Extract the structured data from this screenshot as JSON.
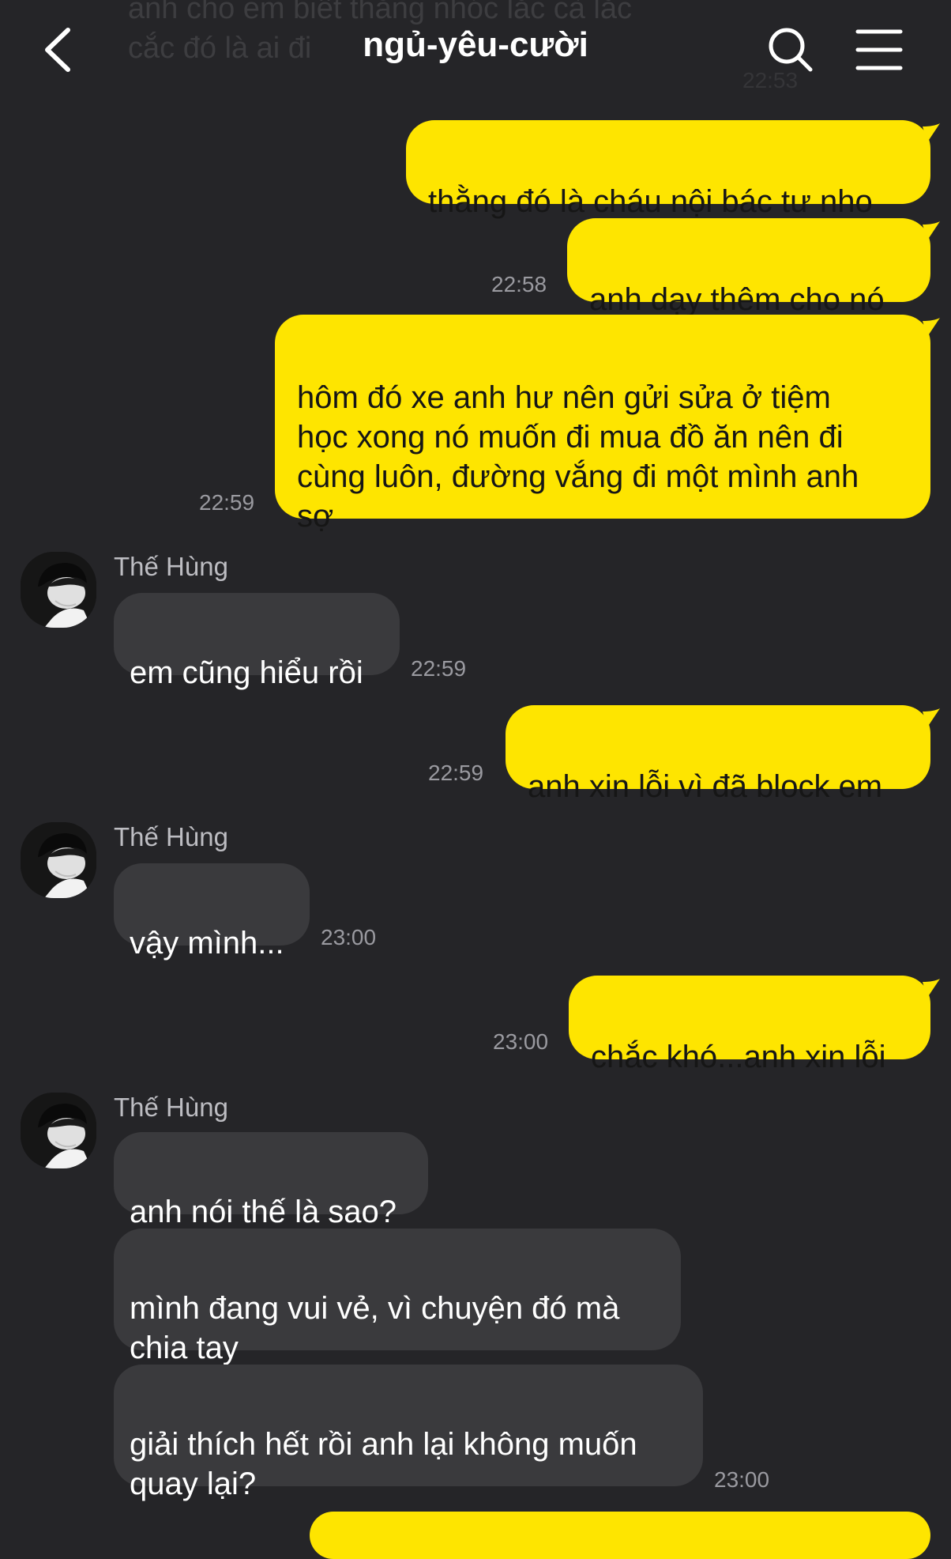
{
  "header": {
    "title": "ngủ-yêu-cười",
    "back_icon": "chevron-left-icon",
    "search_icon": "search-icon",
    "menu_icon": "hamburger-menu-icon"
  },
  "previous_message": {
    "text": "anh cho em biết thằng nhóc lắc cà lắc\ncắc đó là ai đi",
    "time": "22:53"
  },
  "messages": [
    {
      "sender": "me",
      "text": "thằng đó là cháu nội bác tư nho"
    },
    {
      "sender": "me",
      "text": "anh dạy thêm cho nó",
      "time": "22:58"
    },
    {
      "sender": "me",
      "text": "hôm đó xe anh hư nên gửi sửa ở tiệm\nhọc xong nó muốn đi mua đồ ăn nên đi\ncùng luôn, đường vắng đi một mình anh\nsợ",
      "time": "22:59"
    },
    {
      "sender": "Thế Hùng",
      "text": "em cũng hiểu rồi",
      "time": "22:59"
    },
    {
      "sender": "me",
      "text": "anh xin lỗi vì đã block em",
      "time": "22:59"
    },
    {
      "sender": "Thế Hùng",
      "text": "vậy mình...",
      "time": "23:00"
    },
    {
      "sender": "me",
      "text": "chắc khó...anh xin lỗi",
      "time": "23:00"
    },
    {
      "sender": "Thế Hùng",
      "text": "anh nói thế là sao?"
    },
    {
      "sender": "Thế Hùng",
      "text": "mình đang vui vẻ, vì chuyện đó mà\nchia tay"
    },
    {
      "sender": "Thế Hùng",
      "text": "giải thích hết rồi anh lại không muốn\nquay lại?",
      "time": "23:00"
    }
  ],
  "colors": {
    "background": "#252528",
    "outgoing_bubble": "#fee500",
    "incoming_bubble": "#3a3a3d",
    "outgoing_text": "#161616",
    "incoming_text": "#ffffff",
    "timestamp": "#9a9aa0"
  }
}
